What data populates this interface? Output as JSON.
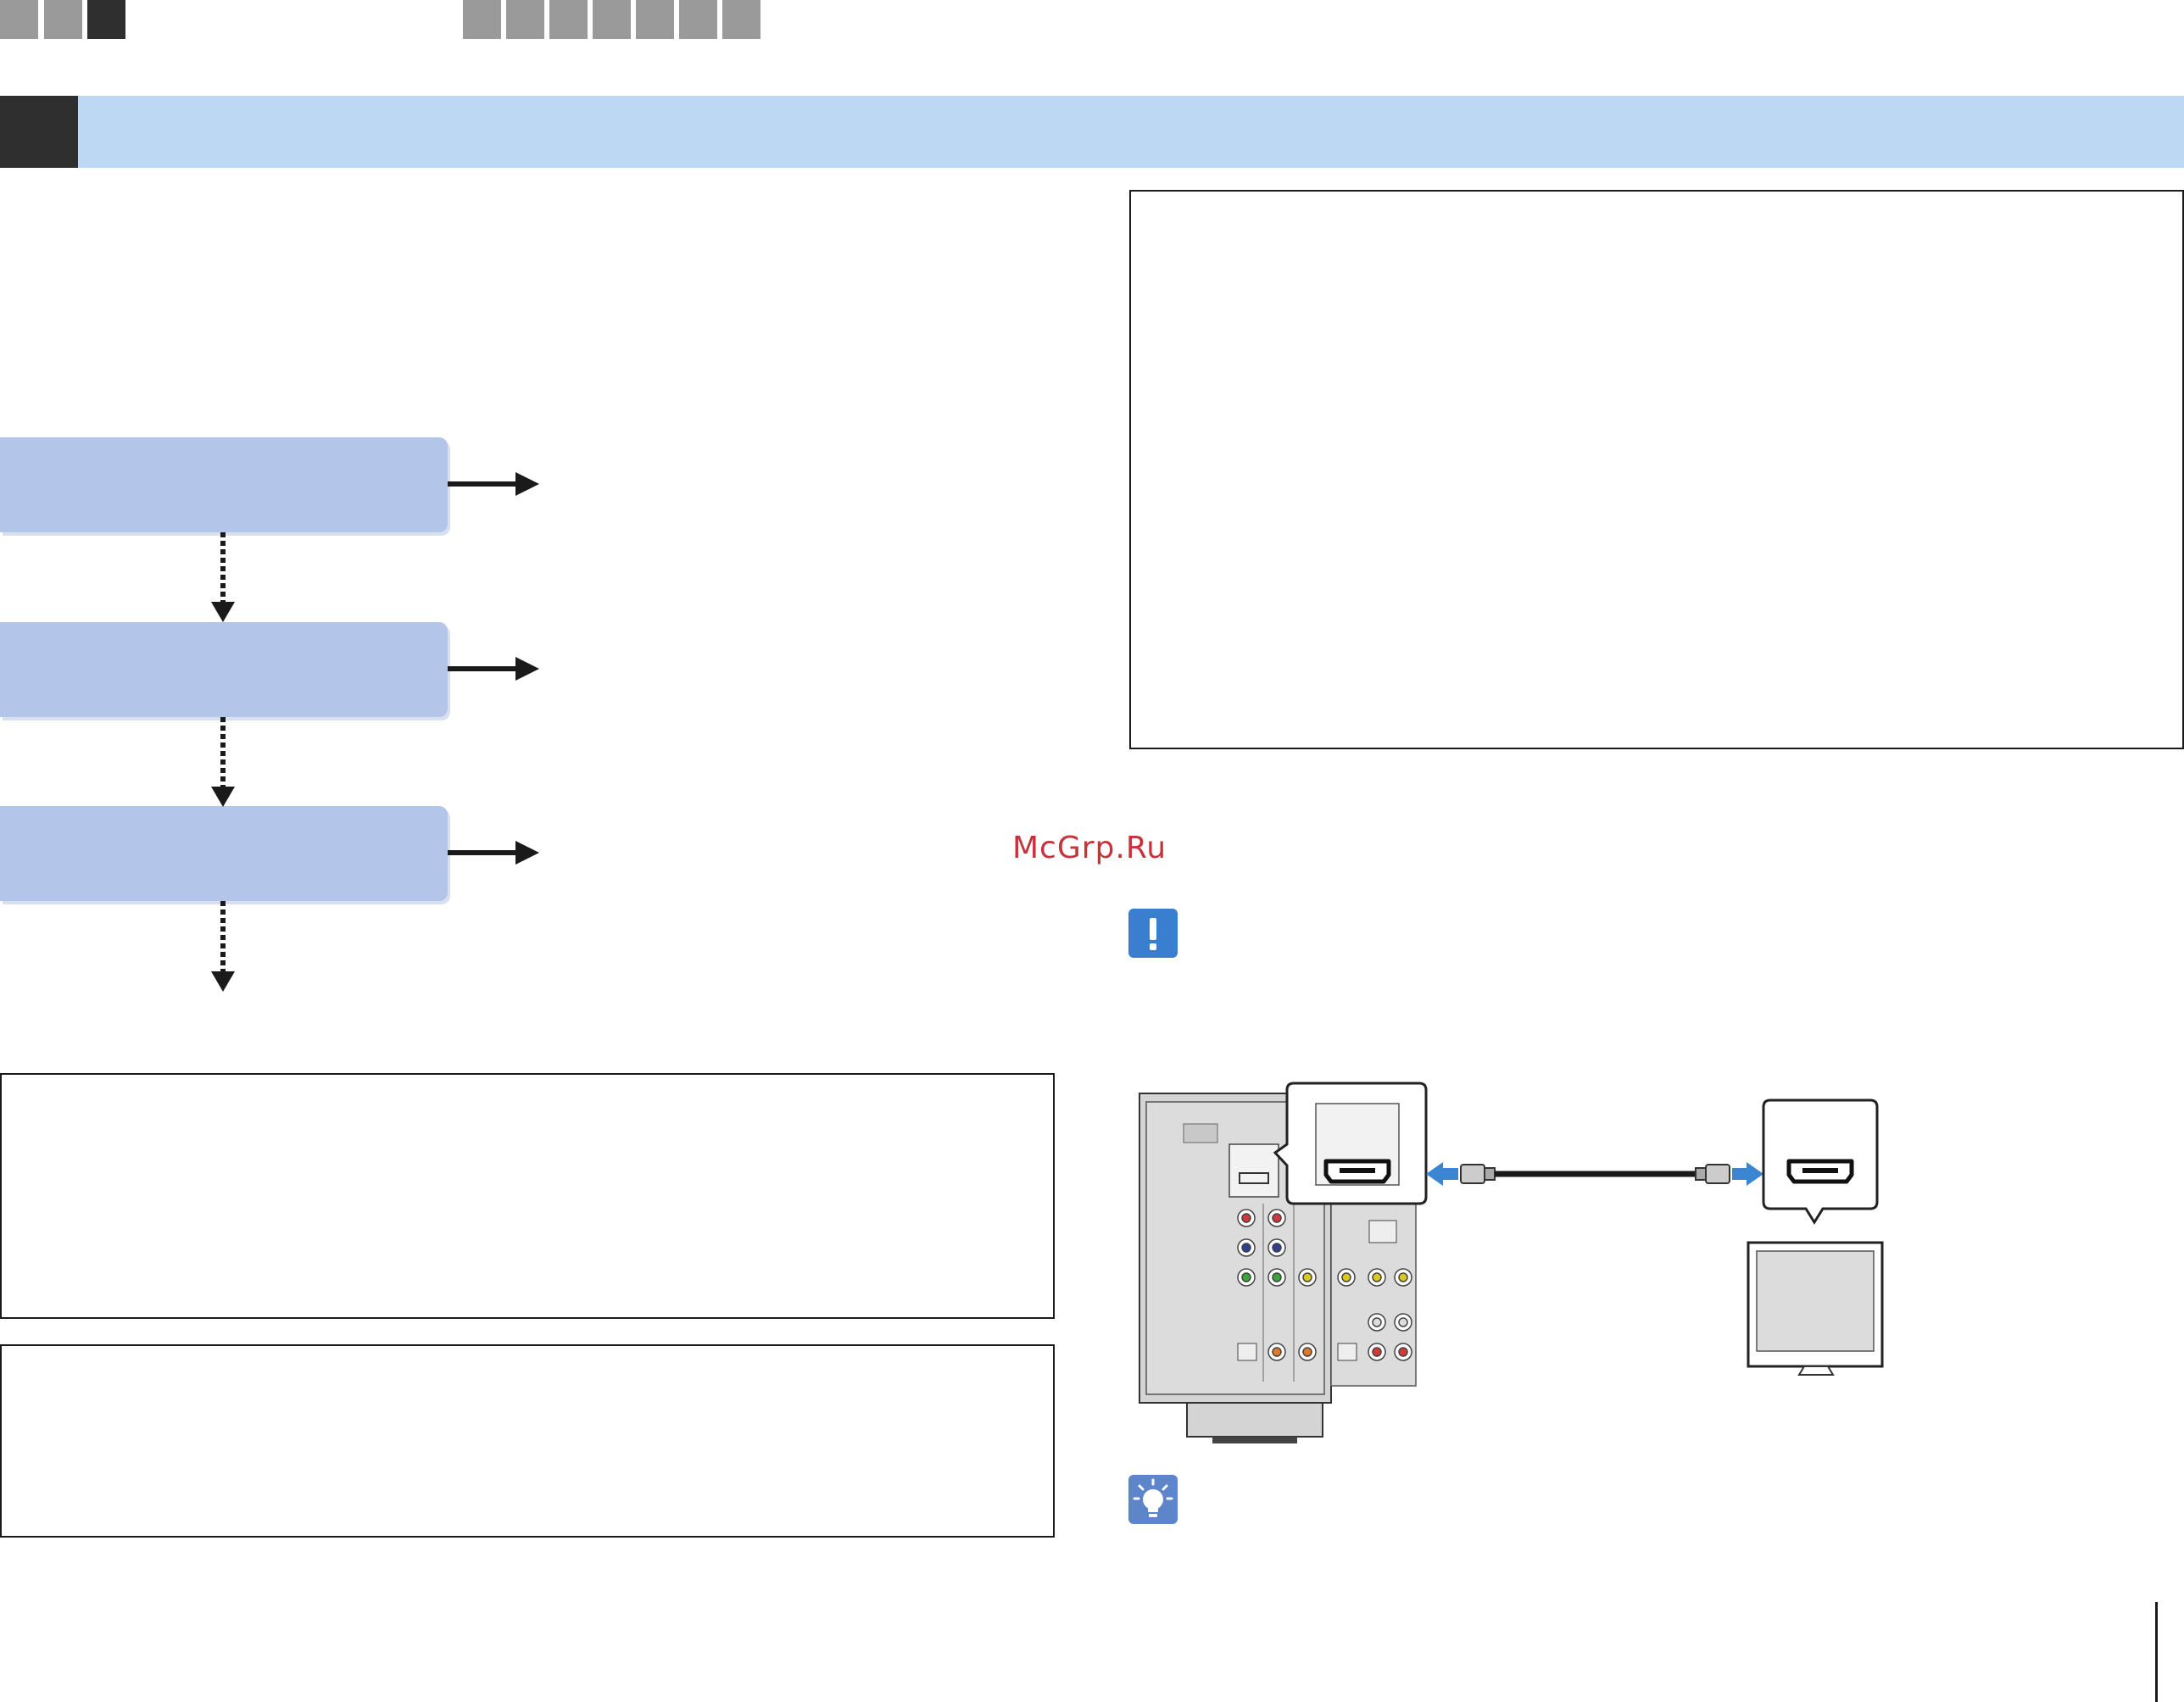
{
  "nav_tabs": {
    "group_left": [
      "",
      "",
      ""
    ],
    "group_right": [
      "",
      "",
      "",
      "",
      "",
      "",
      ""
    ]
  },
  "watermark": {
    "text": "McGrp.Ru"
  },
  "colors": {
    "header_band": "#bcd8f2",
    "flow_box": "#b3c6ea",
    "caution_icon": "#3a7fcf",
    "tip_icon": "#5c86c9",
    "hdmi_arrow": "#3b86d1",
    "watermark": "#c8323a"
  },
  "icons": {
    "caution": "exclamation-icon",
    "tip": "lightbulb-icon"
  },
  "diagram": {
    "left_device": "av-receiver-rear-panel",
    "right_device": "tv",
    "connector": "hdmi",
    "cable": "hdmi-cable"
  }
}
